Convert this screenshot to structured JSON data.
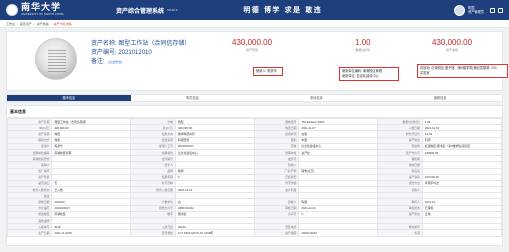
{
  "header": {
    "logo_cn": "南华大学",
    "logo_en": "UNIVERSITY OF SOUTH CHINA",
    "system_title": "资产综合管理系统",
    "version": "V8.30.0",
    "motto": "明德 博学 求是 敢违",
    "user_name": "陈国",
    "user_role": "资产管理员"
  },
  "breadcrumb": {
    "items": [
      "工作台",
      "固定资产",
      "资产档案"
    ],
    "current": "资产卡片详情"
  },
  "summary": {
    "asset_name_label": "资产名称:",
    "asset_name": "图型工作站（合同信存储）",
    "asset_code_label": "资产编号:",
    "asset_code": "2021012010",
    "remark_label": "备注:",
    "remark_link": "[点击修改]",
    "value1": "430,000.00",
    "value1_label": "资产原值",
    "value2": "1.00",
    "value2_label": "数量(台/件)",
    "value3": "430,000.00",
    "value3_label": "资产净值",
    "box1_line1": "使用人: 陈彦华",
    "box2_line1": "使用单位编码: 南湖校区管理",
    "box2_line2": "使用单位: 信息化建设中心",
    "box3_line1": "存放地: 红湖校区-图书馆（第5楼学院)第四层楼屋: 20C",
    "box3_line2": "实验室"
  },
  "tabs": [
    "基本信息",
    "附件信息",
    "变动信息",
    "维修信息"
  ],
  "detail": {
    "title": "基本信息",
    "rows": [
      [
        "资产名称",
        "图型工作站（合同信存储）",
        "分类",
        "微型",
        "规格型号",
        "ThinkStation P620",
        "数量(台/件/套)",
        "1.00"
      ],
      [
        "单价(元)",
        "430,000.00",
        "总价(元)",
        "430,000.00",
        "购置日期",
        "2021-11-07",
        "入账日期",
        "2021-12-01"
      ],
      [
        "资产来源",
        "购置",
        "使用方向",
        "教学科研共同",
        "使用状况",
        "在用",
        "财务凭证号",
        "12-23"
      ],
      [
        "取得方式",
        "购置",
        "经费来源",
        "科研经费",
        "国别",
        "中国",
        "资产用途",
        "科研"
      ],
      [
        "使用人",
        "陈彦华",
        "使用人工号",
        "2021000017",
        "存放",
        "信息化建设中心",
        "存放地",
        "红湖校区-图书馆（第5楼学院)第四层"
      ],
      [
        "使用单位编码",
        "南湖校区管理",
        "使用单位",
        "信息化建设中心",
        "管理单位",
        "资产处",
        "资产卡片号",
        "430000.00"
      ],
      [
        "采购组织形式",
        "",
        "合同编号",
        "",
        "发票号",
        "",
        "保修期",
        ""
      ],
      [
        "采购人",
        "",
        "经手人",
        "",
        "验收人",
        "",
        "验收日期",
        ""
      ],
      [
        "出厂编号",
        "",
        "品牌",
        "联想",
        "厂家/产地",
        "联想(北京)",
        "供应商",
        ""
      ],
      [
        "资产原值",
        "",
        "使用年限",
        "6",
        "已提折旧",
        "",
        "资产净值",
        "430,000.00"
      ],
      [
        "是否进口",
        "否",
        "外币币种",
        "",
        "外币金额",
        "",
        "折旧方法",
        "年限平均法"
      ],
      [
        "财务入账状态",
        "已入账",
        "财务入账日期",
        "2021-12-01",
        "会计科目",
        "",
        "记账人",
        ""
      ],
      [
        "备注",
        "",
        "",
        "",
        "",
        "",
        "",
        ""
      ],
      [
        "建账日期",
        "2019/09",
        "计量单位",
        "台",
        "建账人",
        "陈国",
        "审核人",
        "2021-11"
      ],
      [
        "卡片编号",
        "2021000017",
        "原始卡片号",
        "HBD 001012",
        "审核日期",
        "2021-12-01",
        "审核状态",
        "已审核"
      ],
      [
        "所属校区",
        "南湖校区",
        "楼宇",
        "图书馆",
        "房间号",
        "C",
        "资产状态",
        "正常"
      ],
      [
        "其他说明",
        "",
        "",
        "",
        "",
        "",
        "",
        ""
      ],
      [
        "入账单号",
        "9118",
        "入账凭证",
        "2021A",
        "安装地点",
        "",
        "移交单号",
        ""
      ],
      [
        "生产日期",
        "2021-11-2018",
        "型号规格",
        "1CT P620 HPCS-P1 2018年",
        "资产编码",
        "2021012010",
        "条码",
        ""
      ]
    ]
  }
}
